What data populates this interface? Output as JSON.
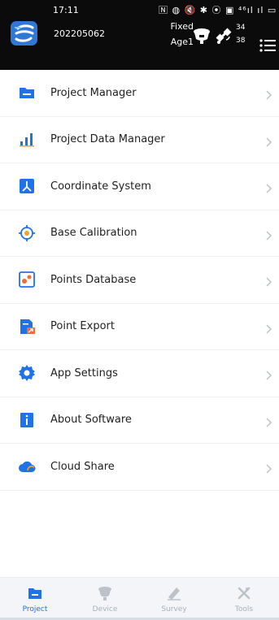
{
  "status_bar": {
    "time": "17:11",
    "icons": "🄽 ◍ 🔇 ✱ ⦿ ▣ ⁴⁶ıl ıl ▭"
  },
  "header": {
    "device_id": "202205062",
    "fix_status": "Fixed",
    "age_label": "Age1",
    "satellites_top": "34",
    "satellites_bottom": "38"
  },
  "menu": [
    {
      "label": "Project Manager",
      "icon": "folder-icon"
    },
    {
      "label": "Project Data Manager",
      "icon": "bar-chart-icon"
    },
    {
      "label": "Coordinate System",
      "icon": "coordinate-system-icon"
    },
    {
      "label": "Base Calibration",
      "icon": "crosshair-icon"
    },
    {
      "label": "Points Database",
      "icon": "points-database-icon"
    },
    {
      "label": "Point Export",
      "icon": "export-file-icon"
    },
    {
      "label": "App Settings",
      "icon": "gear-icon"
    },
    {
      "label": "About Software",
      "icon": "info-icon"
    },
    {
      "label": "Cloud Share",
      "icon": "cloud-share-icon"
    }
  ],
  "tabs": [
    {
      "label": "Project",
      "active": true
    },
    {
      "label": "Device",
      "active": false
    },
    {
      "label": "Survey",
      "active": false
    },
    {
      "label": "Tools",
      "active": false
    }
  ],
  "colors": {
    "accent": "#1f73e6",
    "header_bg": "#0b0b0b",
    "tab_inactive": "#a9b1bb"
  }
}
